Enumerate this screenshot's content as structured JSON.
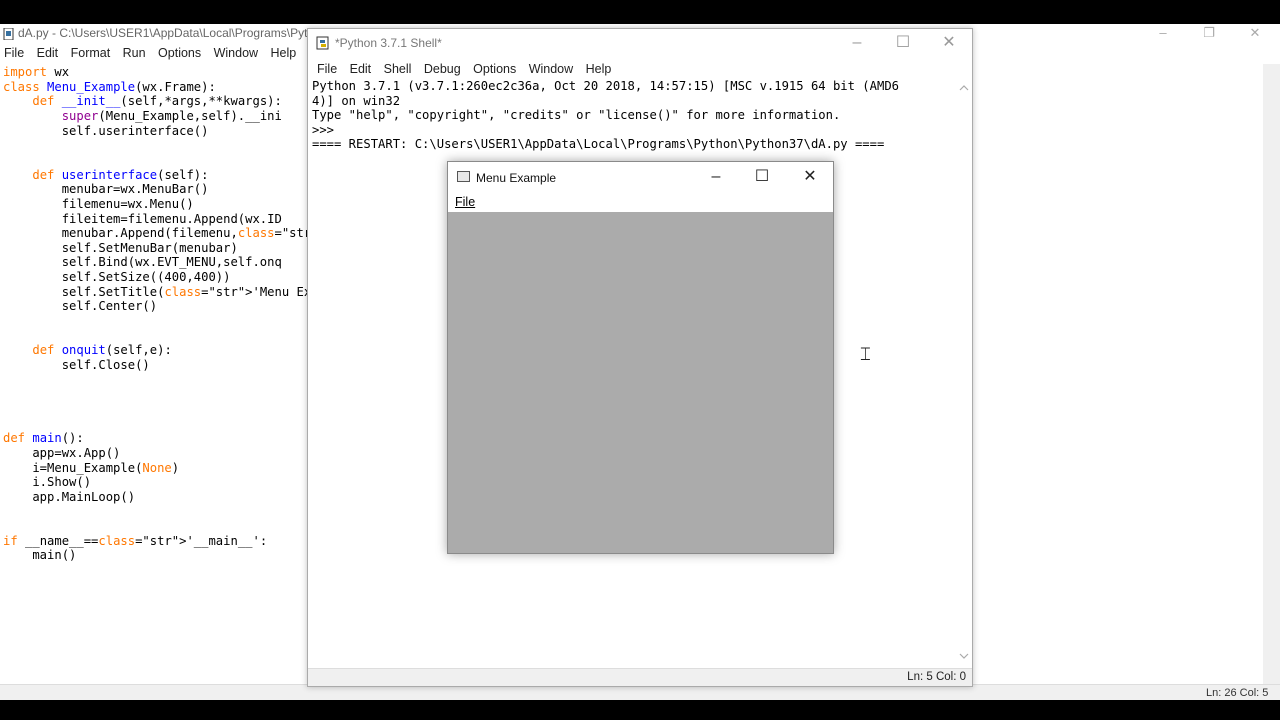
{
  "editor": {
    "title": "dA.py - C:\\Users\\USER1\\AppData\\Local\\Programs\\Pyt",
    "menu": [
      "File",
      "Edit",
      "Format",
      "Run",
      "Options",
      "Window",
      "Help"
    ],
    "status": "Ln: 26 Col: 5",
    "code": [
      "import wx",
      "class Menu_Example(wx.Frame):",
      "    def __init__(self,*args,**kwargs):",
      "        super(Menu_Example,self).__ini",
      "        self.userinterface()",
      "",
      "",
      "    def userinterface(self):",
      "        menubar=wx.MenuBar()",
      "        filemenu=wx.Menu()",
      "        fileitem=filemenu.Append(wx.ID",
      "        menubar.Append(filemenu,'&File",
      "        self.SetMenuBar(menubar)",
      "        self.Bind(wx.EVT_MENU,self.onq",
      "        self.SetSize((400,400))",
      "        self.SetTitle('Menu Example')",
      "        self.Center()",
      "",
      "",
      "    def onquit(self,e):",
      "        self.Close()",
      "",
      "",
      "",
      "",
      "def main():",
      "    app=wx.App()",
      "    i=Menu_Example(None)",
      "    i.Show()",
      "    app.MainLoop()",
      "",
      "",
      "if __name__=='__main__':",
      "    main()"
    ]
  },
  "shell": {
    "title": "*Python 3.7.1 Shell*",
    "menu": [
      "File",
      "Edit",
      "Shell",
      "Debug",
      "Options",
      "Window",
      "Help"
    ],
    "status": "Ln: 5  Col: 0",
    "output": [
      "Python 3.7.1 (v3.7.1:260ec2c36a, Oct 20 2018, 14:57:15) [MSC v.1915 64 bit (AMD6",
      "4)] on win32",
      "Type \"help\", \"copyright\", \"credits\" or \"license()\" for more information.",
      ">>> ",
      "==== RESTART: C:\\Users\\USER1\\AppData\\Local\\Programs\\Python\\Python37\\dA.py ===="
    ]
  },
  "frame": {
    "title": "Menu Example",
    "menu_file": "File"
  },
  "icons": {
    "minimize": "minimize-icon",
    "maximize": "maximize-icon",
    "close": "close-icon",
    "restore": "restore-icon"
  }
}
